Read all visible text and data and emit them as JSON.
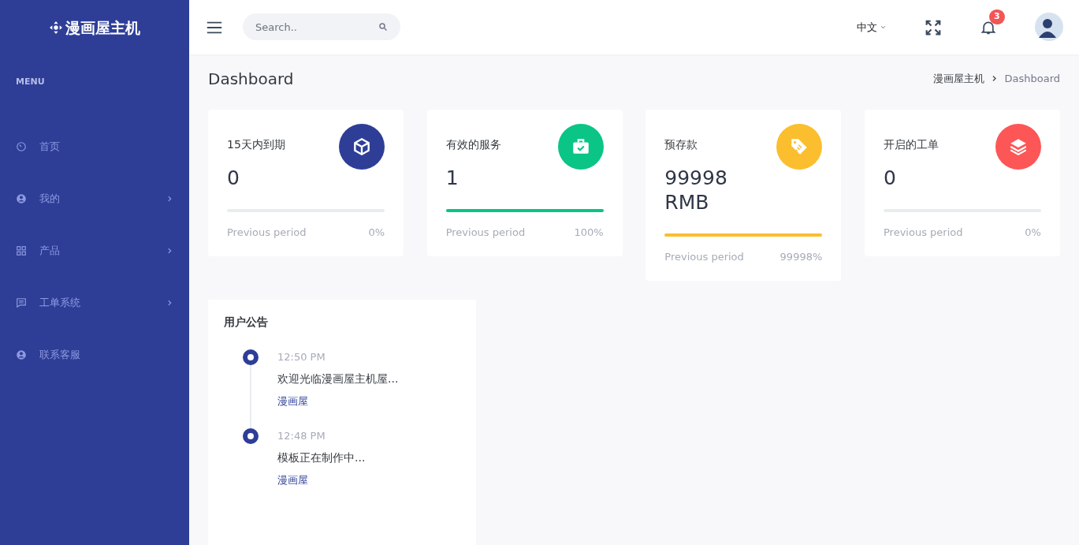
{
  "brand": {
    "title": "漫画屋主机"
  },
  "sidebar": {
    "heading": "MENU",
    "items": [
      {
        "label": "首页",
        "has_submenu": false
      },
      {
        "label": "我的",
        "has_submenu": true
      },
      {
        "label": "产品",
        "has_submenu": true
      },
      {
        "label": "工单系统",
        "has_submenu": true
      },
      {
        "label": "联系客服",
        "has_submenu": false
      }
    ]
  },
  "topbar": {
    "search": {
      "placeholder": "Search.."
    },
    "language": "中文",
    "notifications": "3"
  },
  "page": {
    "title": "Dashboard",
    "breadcrumb": [
      {
        "label": "漫画屋主机",
        "selected": false
      },
      {
        "label": "Dashboard",
        "selected": true
      }
    ]
  },
  "stats": [
    {
      "title": "15天内到期",
      "value": "0",
      "color": "#2e3e97",
      "level": 0,
      "footer": "Previous period",
      "percent": "0%"
    },
    {
      "title": "有效的服务",
      "value": "1",
      "color": "#0ac585",
      "level": 1,
      "footer": "Previous period",
      "percent": "100%"
    },
    {
      "title": "预存款",
      "value": "99998 RMB",
      "color": "#fbbe2e",
      "level": 1,
      "footer": "Previous period",
      "percent": "99998%"
    },
    {
      "title": "开启的工单",
      "value": "0",
      "color": "#fd5656",
      "level": 0,
      "footer": "Previous period",
      "percent": "0%"
    }
  ],
  "announcements": {
    "title": "用户公告",
    "items": [
      {
        "time": "12:50 PM",
        "text": "欢迎光临漫画屋主机屋...",
        "author": "漫画屋"
      },
      {
        "time": "12:48 PM",
        "text": "模板正在制作中...",
        "author": "漫画屋"
      }
    ]
  }
}
